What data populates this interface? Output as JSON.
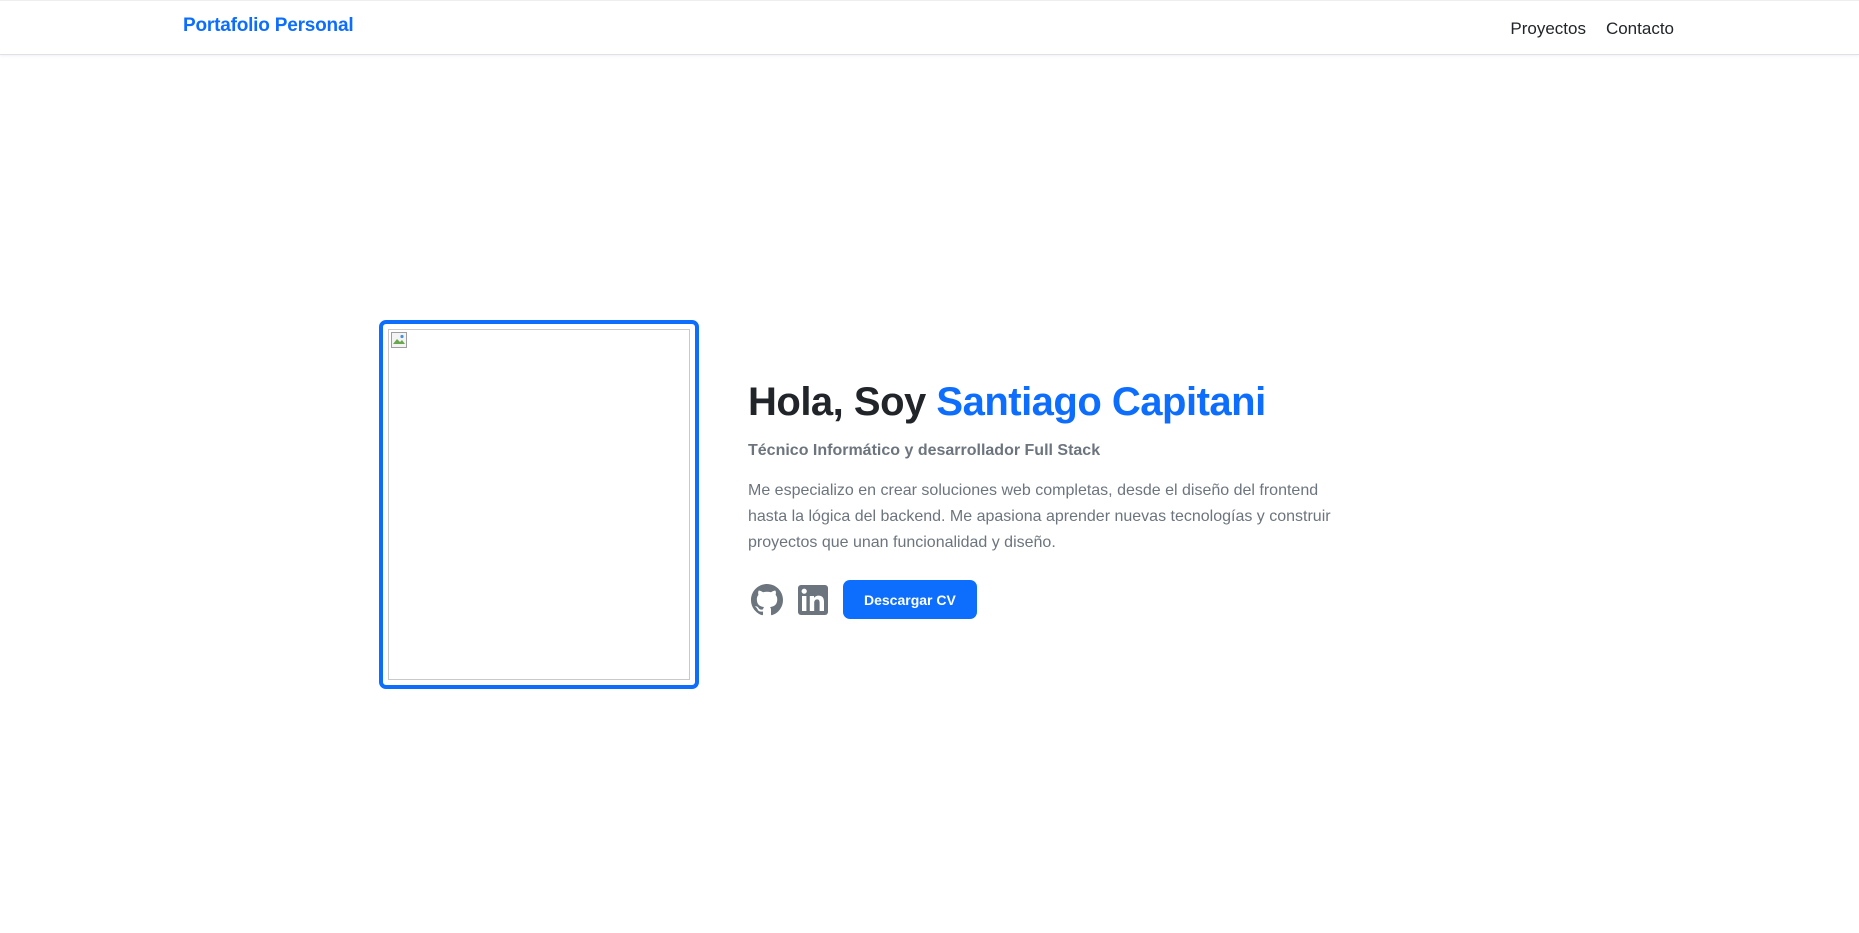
{
  "navbar": {
    "brand": "Portafolio Personal",
    "links": [
      "Proyectos",
      "Contacto"
    ]
  },
  "hero": {
    "greeting": "Hola, Soy ",
    "name": "Santiago Capitani",
    "subtitle": "Técnico Informático y desarrollador Full Stack",
    "description": "Me especializo en crear soluciones web completas, desde el diseño del frontend hasta la lógica del backend. Me apasiona aprender nuevas tecnologías y construir proyectos que unan funcionalidad y diseño.",
    "cv_button": "Descargar CV"
  },
  "icons": {
    "github": "github-icon",
    "linkedin": "linkedin-icon",
    "photo_placeholder": "broken-image-icon"
  },
  "colors": {
    "accent": "#0d6efd",
    "text": "#212529",
    "muted": "#6c757d",
    "social": "#6c757d"
  }
}
